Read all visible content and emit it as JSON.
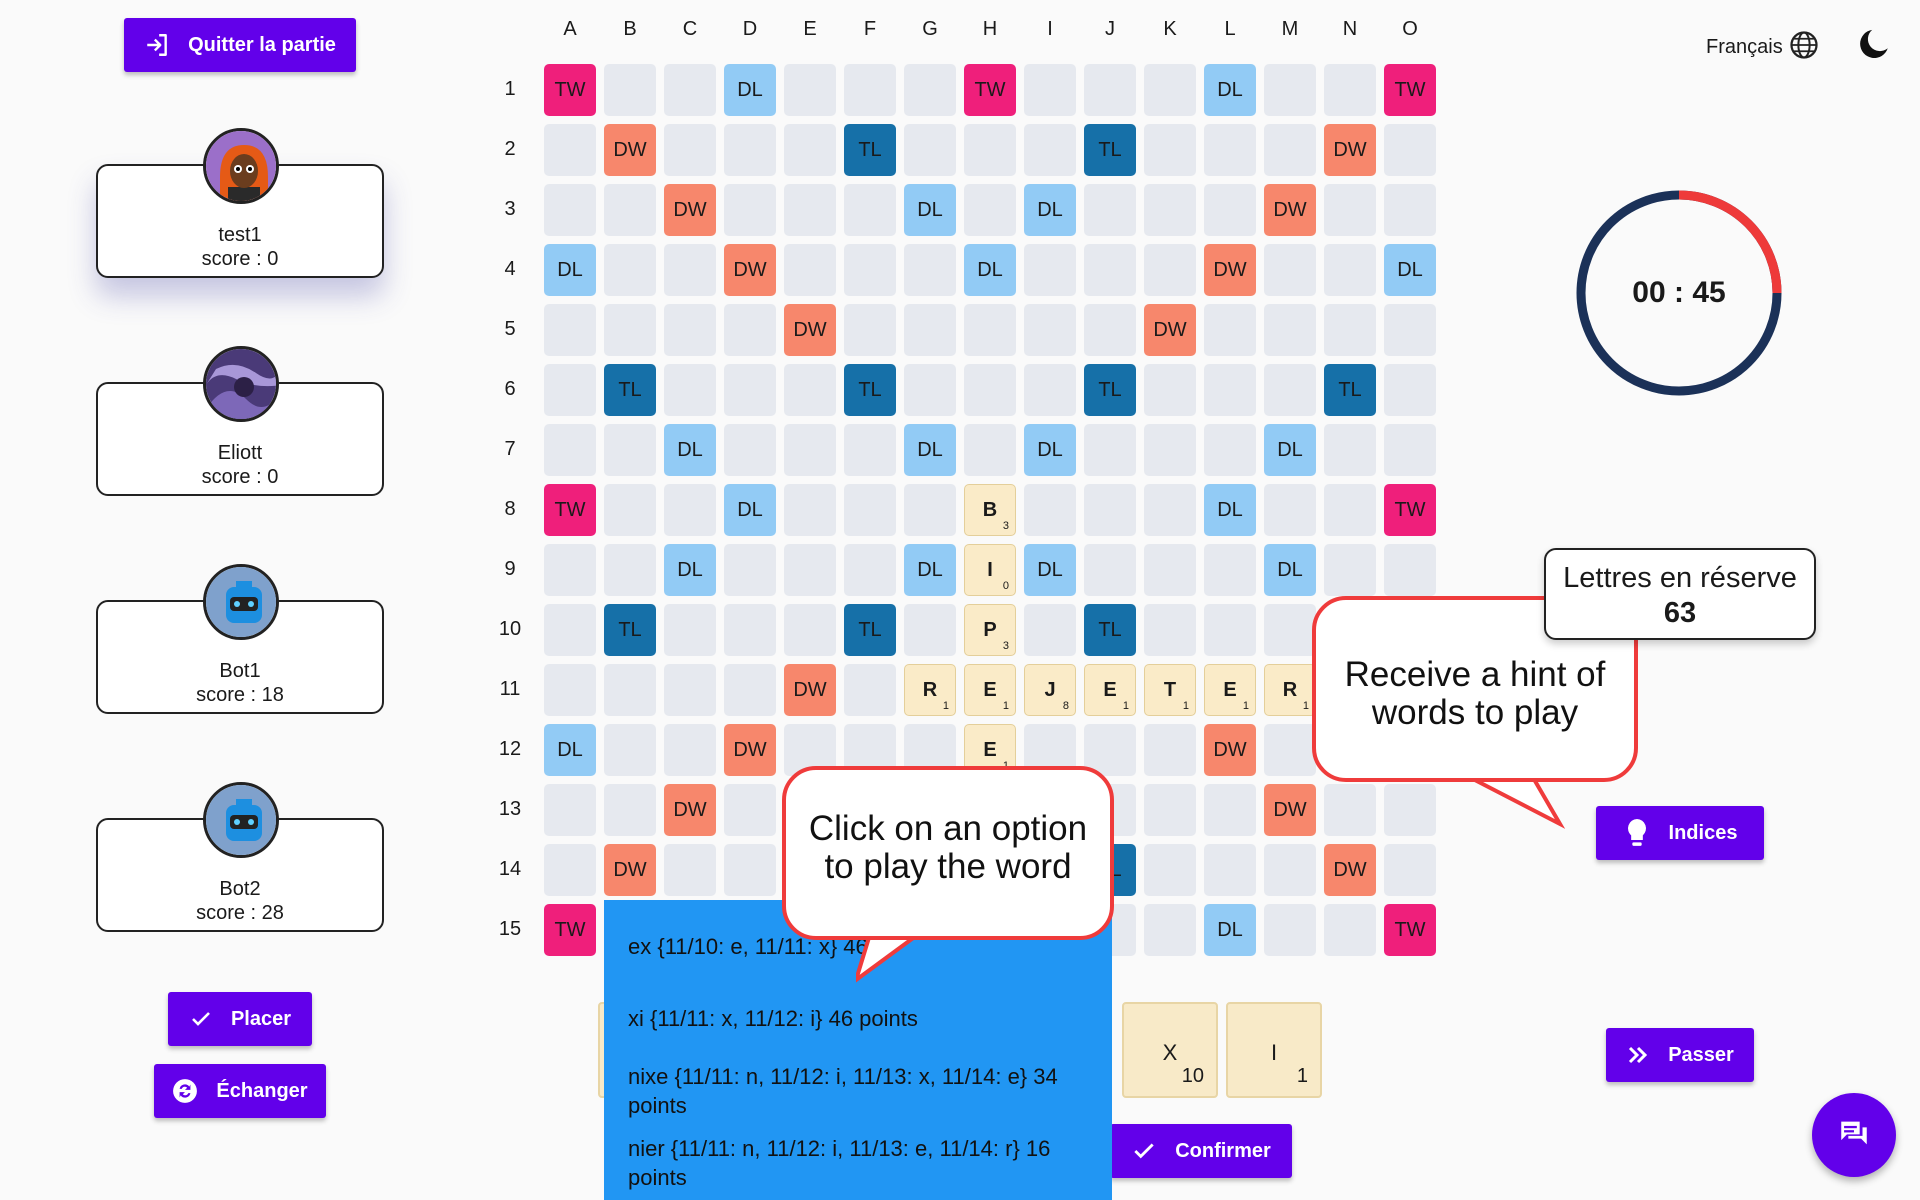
{
  "top": {
    "quit_label": "Quitter la partie",
    "language_label": "Français"
  },
  "players": [
    {
      "name": "test1",
      "score": "score : 0"
    },
    {
      "name": "Eliott",
      "score": "score : 0"
    },
    {
      "name": "Bot1",
      "score": "score : 18"
    },
    {
      "name": "Bot2",
      "score": "score : 28"
    }
  ],
  "board": {
    "columns": [
      "A",
      "B",
      "C",
      "D",
      "E",
      "F",
      "G",
      "H",
      "I",
      "J",
      "K",
      "L",
      "M",
      "N",
      "O"
    ],
    "rows": [
      "1",
      "2",
      "3",
      "4",
      "5",
      "6",
      "7",
      "8",
      "9",
      "10",
      "11",
      "12",
      "13",
      "14",
      "15"
    ],
    "placed_letters": [
      {
        "cell": "H8",
        "letter": "B",
        "points": "3"
      },
      {
        "cell": "H9",
        "letter": "I",
        "points": "0"
      },
      {
        "cell": "H10",
        "letter": "P",
        "points": "3"
      },
      {
        "cell": "G11",
        "letter": "R",
        "points": "1"
      },
      {
        "cell": "H11",
        "letter": "E",
        "points": "1"
      },
      {
        "cell": "I11",
        "letter": "J",
        "points": "8"
      },
      {
        "cell": "J11",
        "letter": "E",
        "points": "1"
      },
      {
        "cell": "K11",
        "letter": "T",
        "points": "1"
      },
      {
        "cell": "L11",
        "letter": "E",
        "points": "1"
      },
      {
        "cell": "M11",
        "letter": "R",
        "points": "1"
      },
      {
        "cell": "H12",
        "letter": "E",
        "points": "1"
      }
    ]
  },
  "timer": {
    "display": "00 : 45",
    "remaining_fraction": 0.75
  },
  "reserve": {
    "label": "Lettres en réserve",
    "count": "63"
  },
  "actions": {
    "hints_label": "Indices",
    "pass_label": "Passer",
    "place_label": "Placer",
    "exchange_label": "Échanger",
    "confirm_label": "Confirmer"
  },
  "rack": [
    {
      "letter": "X",
      "points": "10"
    },
    {
      "letter": "I",
      "points": "1"
    }
  ],
  "hints": [
    {
      "text": "ex {11/10: e, 11/11: x} 46"
    },
    {
      "text": "xi {11/11: x, 11/12: i} 46 points"
    },
    {
      "text": "nixe {11/11: n, 11/12: i, 11/13: x, 11/14: e} 34 points"
    },
    {
      "text": "nier {11/11: n, 11/12: i, 11/13: e, 11/14: r} 16 points"
    }
  ],
  "callouts": {
    "hint_callout": "Receive a hint of words to play",
    "option_callout": "Click on an option to play the word"
  },
  "colors": {
    "accent": "#6200ea",
    "tw": "#ef1f7b",
    "dw": "#f7876c",
    "dl": "#92cbf5",
    "tl": "#1670a8",
    "tile": "#faebc8",
    "hint_list": "#2196f3",
    "timer_ring": "#1b3158",
    "timer_elapsed": "#ee3a3a",
    "callout_border": "#ef3b3b"
  }
}
